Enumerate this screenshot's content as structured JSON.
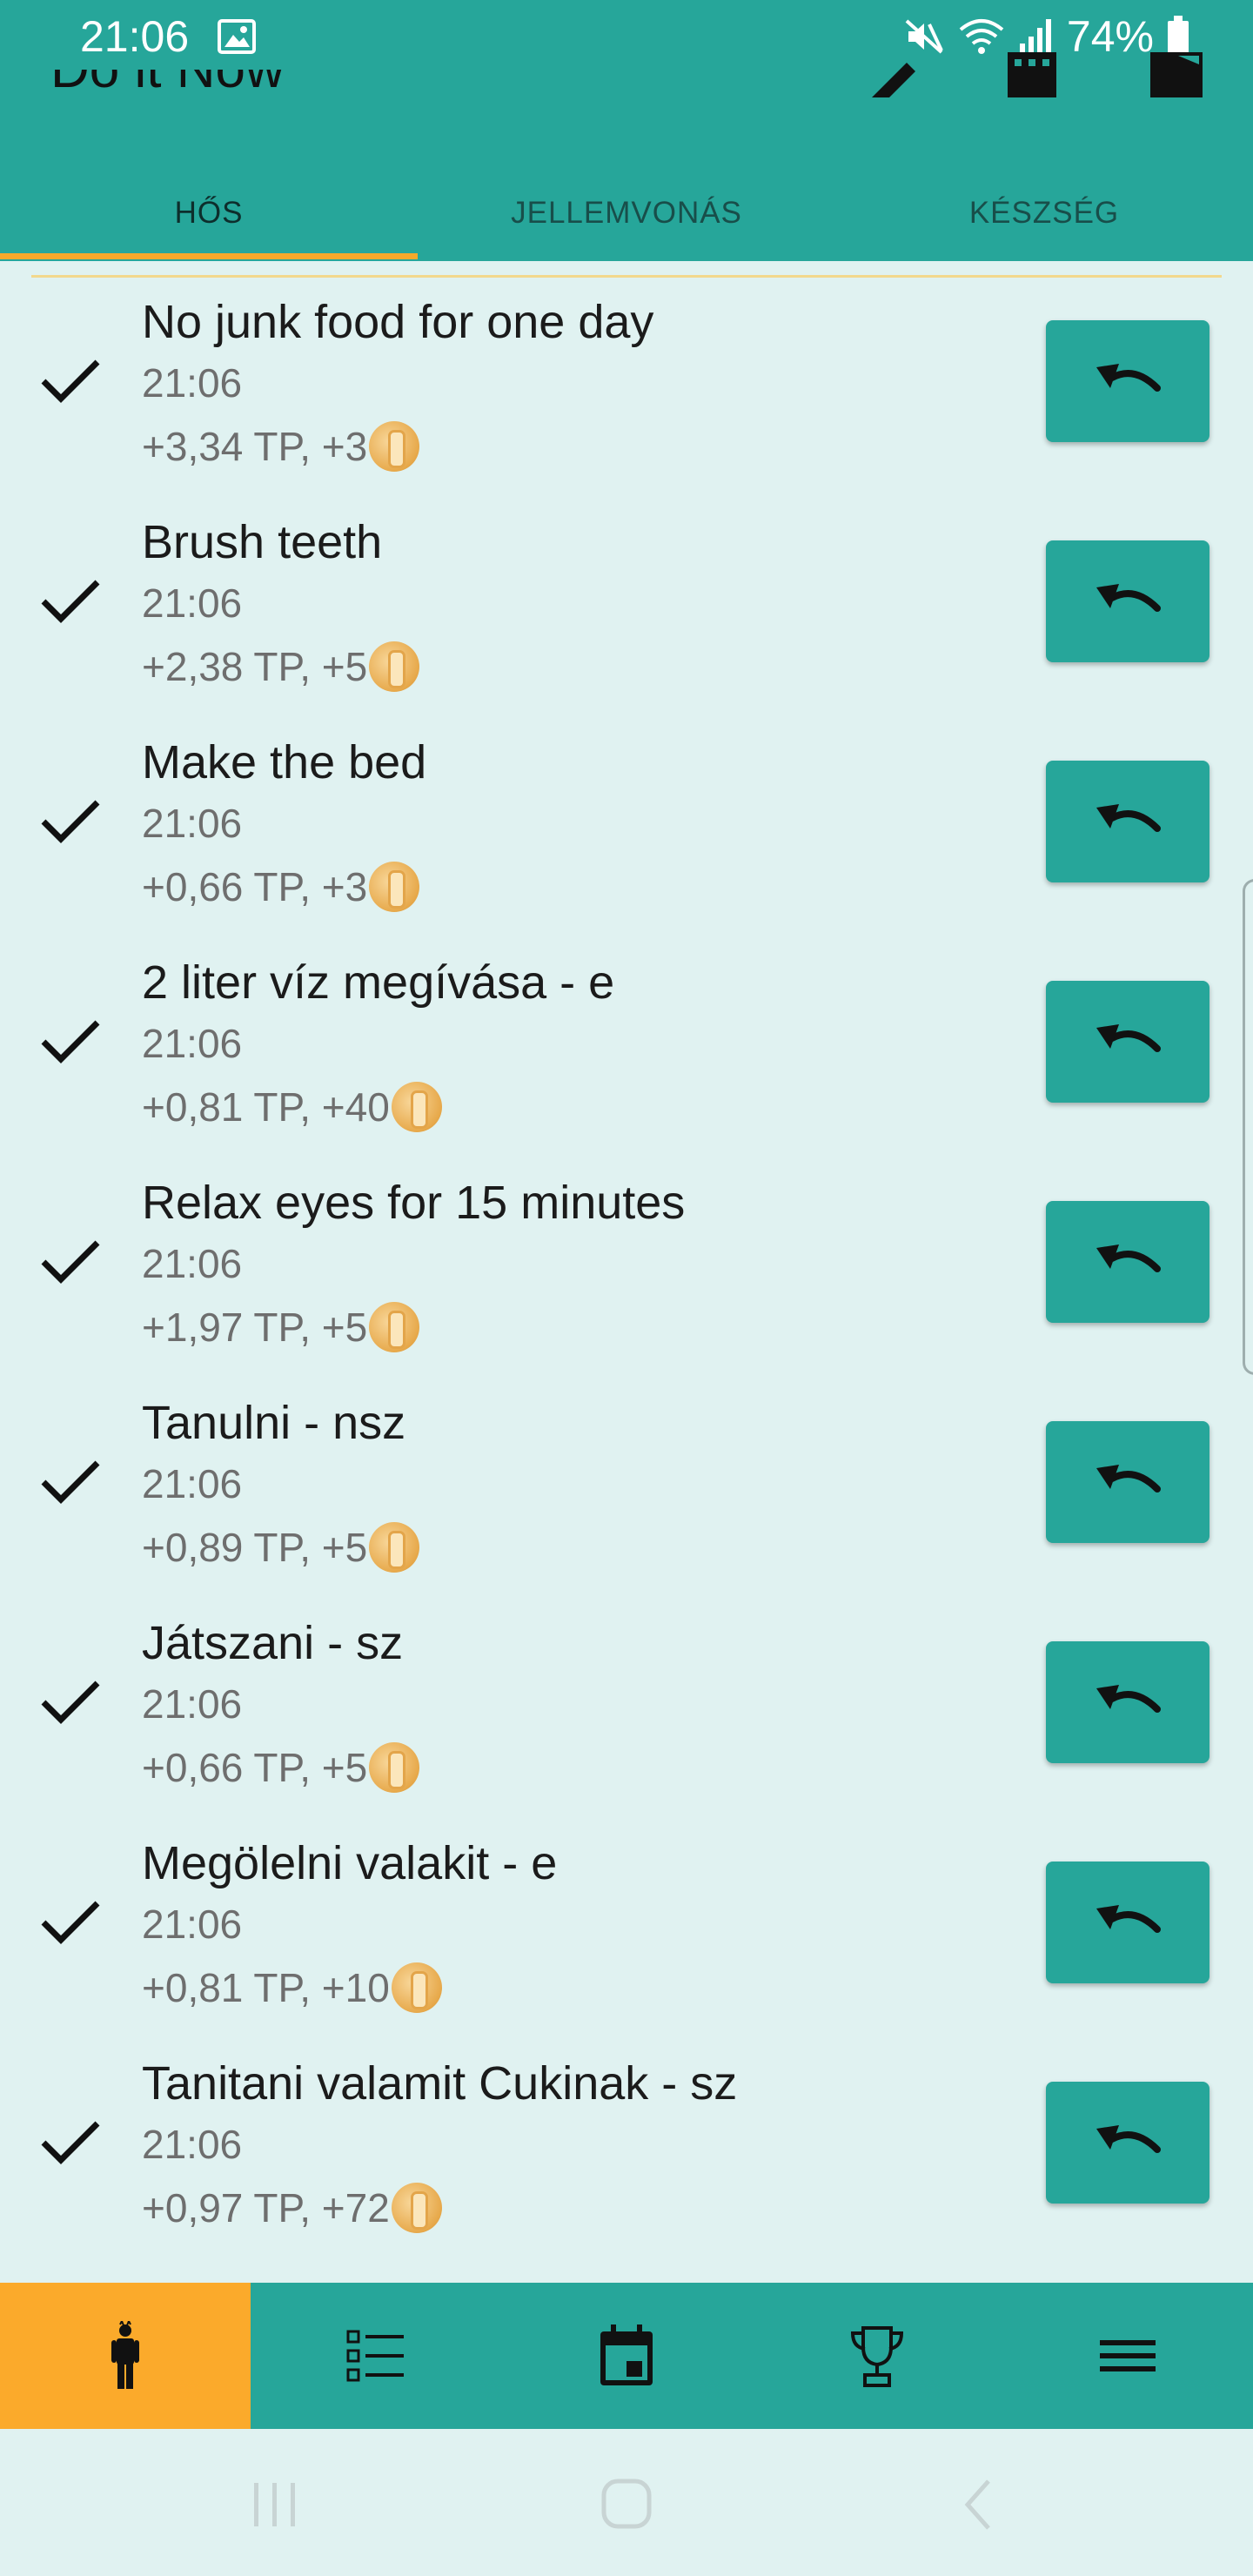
{
  "status_bar": {
    "time": "21:06",
    "battery": "74%"
  },
  "app": {
    "title": "Do it Now",
    "accent": "#26a69a",
    "highlight": "#fbaa2b"
  },
  "tabs": [
    {
      "label": "HŐS",
      "active": true
    },
    {
      "label": "JELLEMVONÁS",
      "active": false
    },
    {
      "label": "KÉSZSÉG",
      "active": false
    }
  ],
  "tasks": [
    {
      "title": "No junk food for one day",
      "time": "21:06",
      "reward": "+3,34 TP, +3"
    },
    {
      "title": "Brush teeth",
      "time": "21:06",
      "reward": "+2,38 TP, +5"
    },
    {
      "title": "Make the bed",
      "time": "21:06",
      "reward": "+0,66 TP, +3"
    },
    {
      "title": "2 liter víz megívása - e",
      "time": "21:06",
      "reward": "+0,81 TP, +40"
    },
    {
      "title": "Relax eyes for 15 minutes",
      "time": "21:06",
      "reward": "+1,97 TP, +5"
    },
    {
      "title": "Tanulni - nsz",
      "time": "21:06",
      "reward": "+0,89 TP, +5"
    },
    {
      "title": "Játszani - sz",
      "time": "21:06",
      "reward": "+0,66 TP, +5"
    },
    {
      "title": "Megölelni valakit - e",
      "time": "21:06",
      "reward": "+0,81 TP, +10"
    },
    {
      "title": "Tanitani valamit Cukinak - sz",
      "time": "21:06",
      "reward": "+0,97 TP, +72"
    }
  ],
  "bottom_nav": [
    {
      "icon": "hero-icon",
      "active": true
    },
    {
      "icon": "list-icon",
      "active": false
    },
    {
      "icon": "calendar-icon",
      "active": false
    },
    {
      "icon": "trophy-icon",
      "active": false
    },
    {
      "icon": "menu-icon",
      "active": false
    }
  ]
}
